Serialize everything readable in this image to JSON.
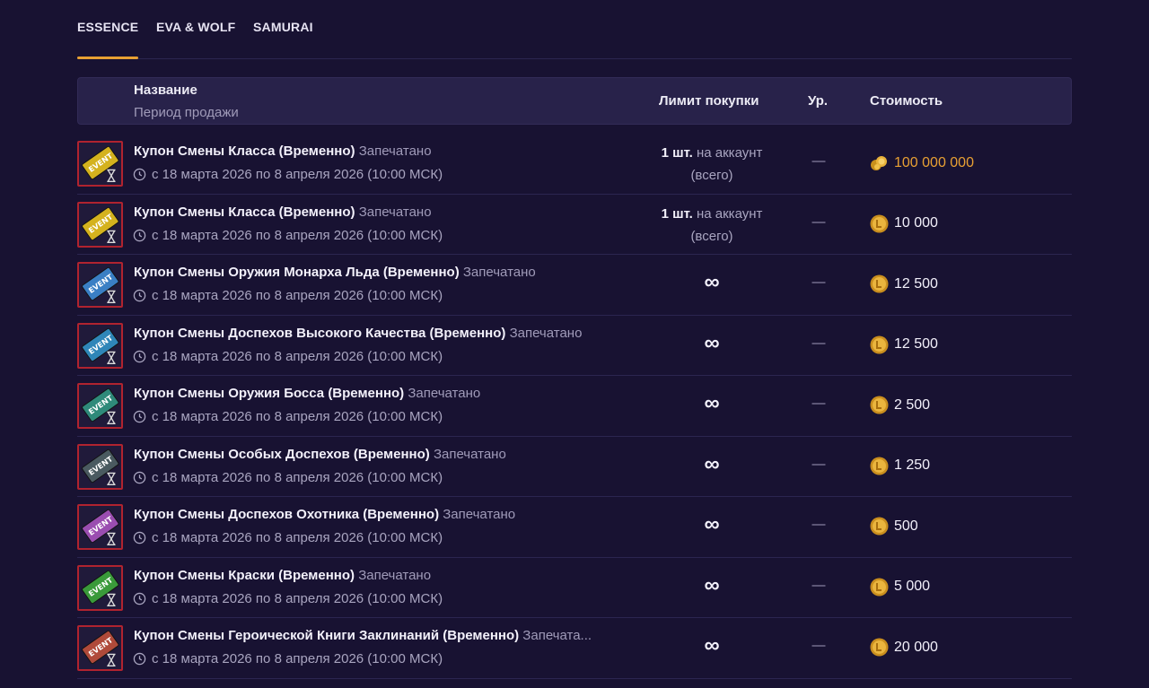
{
  "tabs": [
    "ESSENCE",
    "EVA & WOLF",
    "SAMURAI"
  ],
  "header": {
    "name": "Название",
    "period": "Период продажи",
    "limit": "Лимит покупки",
    "level": "Ур.",
    "cost": "Стоимость"
  },
  "colors": {
    "accent": "#e8a033",
    "background": "#181232",
    "header_bg": "#28224a"
  },
  "rows": [
    {
      "title": "Купон Смены Класса (Временно)",
      "status": "Запечатано",
      "period": "с 18 марта 2026 по 8 апреля 2026 (10:00 МСК)",
      "limit_count": "1 шт.",
      "limit_rest": "на аккаунт",
      "limit_line2": "(всего)",
      "level": "—",
      "cost": "100 000 000",
      "currency_icon": "gold-pile-icon",
      "icon_color": "#d4b21e"
    },
    {
      "title": "Купон Смены Класса (Временно)",
      "status": "Запечатано",
      "period": "с 18 марта 2026 по 8 апреля 2026 (10:00 МСК)",
      "limit_count": "1 шт.",
      "limit_rest": "на аккаунт",
      "limit_line2": "(всего)",
      "level": "—",
      "cost": "10 000",
      "currency_icon": "coin-icon",
      "icon_color": "#d4b21e"
    },
    {
      "title": "Купон Смены Оружия Монарха Льда (Временно)",
      "status": "Запечатано",
      "period": "с 18 марта 2026 по 8 апреля 2026 (10:00 МСК)",
      "limit_symbol": "∞",
      "level": "—",
      "cost": "12 500",
      "currency_icon": "coin-icon",
      "icon_color": "#3a7fc4"
    },
    {
      "title": "Купон Смены Доспехов Высокого Качества (Временно)",
      "status": "Запечатано",
      "period": "с 18 марта 2026 по 8 апреля 2026 (10:00 МСК)",
      "limit_symbol": "∞",
      "level": "—",
      "cost": "12 500",
      "currency_icon": "coin-icon",
      "icon_color": "#2f86b8"
    },
    {
      "title": "Купон Смены Оружия Босса (Временно)",
      "status": "Запечатано",
      "period": "с 18 марта 2026 по 8 апреля 2026 (10:00 МСК)",
      "limit_symbol": "∞",
      "level": "—",
      "cost": "2 500",
      "currency_icon": "coin-icon",
      "icon_color": "#2f8a7a"
    },
    {
      "title": "Купон Смены Особых Доспехов (Временно)",
      "status": "Запечатано",
      "period": "с 18 марта 2026 по 8 апреля 2026 (10:00 МСК)",
      "limit_symbol": "∞",
      "level": "—",
      "cost": "1 250",
      "currency_icon": "coin-icon",
      "icon_color": "#4a5a60"
    },
    {
      "title": "Купон Смены Доспехов Охотника (Временно)",
      "status": "Запечатано",
      "period": "с 18 марта 2026 по 8 апреля 2026 (10:00 МСК)",
      "limit_symbol": "∞",
      "level": "—",
      "cost": "500",
      "currency_icon": "coin-icon",
      "icon_color": "#9a4db0"
    },
    {
      "title": "Купон Смены Краски (Временно)",
      "status": "Запечатано",
      "period": "с 18 марта 2026 по 8 апреля 2026 (10:00 МСК)",
      "limit_symbol": "∞",
      "level": "—",
      "cost": "5 000",
      "currency_icon": "coin-icon",
      "icon_color": "#3a9a3a"
    },
    {
      "title": "Купон Смены Героической Книги Заклинаний (Временно)",
      "status": "Запечата...",
      "period": "с 18 марта 2026 по 8 апреля 2026 (10:00 МСК)",
      "limit_symbol": "∞",
      "level": "—",
      "cost": "20 000",
      "currency_icon": "coin-icon",
      "icon_color": "#b04a3a"
    }
  ]
}
